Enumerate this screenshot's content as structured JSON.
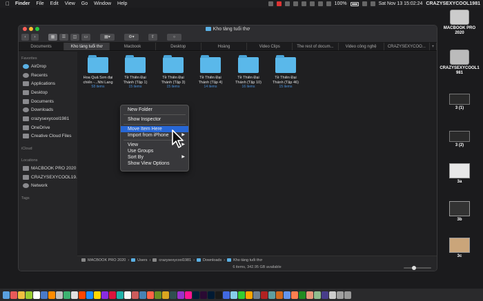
{
  "menubar": {
    "app": "Finder",
    "menus": [
      "File",
      "Edit",
      "View",
      "Go",
      "Window",
      "Help"
    ],
    "battery": "100%",
    "datetime": "Sat Nov 13  15:02:24",
    "user": "CRAZYSEXYCOOL1981",
    "icons": [
      "apple-icon",
      "wifi-icon",
      "battery-icon",
      "search-icon",
      "control-center-icon"
    ]
  },
  "window": {
    "title": "Kho tàng tuổi thơ",
    "tabs": [
      {
        "label": "Documents",
        "active": false
      },
      {
        "label": "Kho tàng tuổi thơ",
        "active": true
      },
      {
        "label": "Macbook",
        "active": false
      },
      {
        "label": "Desktop",
        "active": false
      },
      {
        "label": "Hoàng",
        "active": false
      },
      {
        "label": "Video Clips",
        "active": false
      },
      {
        "label": "The rest of docum...",
        "active": false
      },
      {
        "label": "Video công nghệ",
        "active": false
      },
      {
        "label": "CRAZYSEXYCOO...",
        "active": false
      },
      {
        "label": "+",
        "active": false
      }
    ],
    "sidebar": {
      "favorites_header": "Favorites",
      "favorites": [
        "AirDrop",
        "Recents",
        "Applications",
        "Desktop",
        "Documents",
        "Downloads",
        "crazysexycool1981",
        "OneDrive",
        "Creative Cloud Files"
      ],
      "icloud_header": "iCloud",
      "locations_header": "Locations",
      "locations": [
        "MACBOOK PRO 2020",
        "CRAZYSEXYCOOL19...",
        "Network"
      ],
      "tags_header": "Tags"
    },
    "folders": [
      {
        "name1": "Hoa Quả Sơn đại",
        "name2": "chiến -...Nhi Lang",
        "count": "58 items"
      },
      {
        "name1": "Tề Thiên Đại",
        "name2": "Thánh (Tập 1)",
        "count": "15 items"
      },
      {
        "name1": "Tề Thiên Đại",
        "name2": "Thánh (Tập 3)",
        "count": "15 items"
      },
      {
        "name1": "Tề Thiên Đại",
        "name2": "Thánh (Tập 4)",
        "count": "14 items"
      },
      {
        "name1": "Tề Thiên Đại",
        "name2": "Thánh (Tập 10)",
        "count": "16 items"
      },
      {
        "name1": "Tề Thiên Đại",
        "name2": "Thánh (Tập 46)",
        "count": "15 items"
      }
    ],
    "pathbar": [
      "MACBOOK PRO 2020",
      "Users",
      "crazysexycool1981",
      "Downloads",
      "Kho tàng tuổi thơ"
    ],
    "status": "6 items, 342.95 GB available",
    "icon_size_level": 0.35
  },
  "context_menu": {
    "new_folder": "New Folder",
    "show_inspector": "Show Inspector",
    "move_item_here": "Move Item Here",
    "import_from_iphone": "Import from iPhone",
    "view": "View",
    "use_groups": "Use Groups",
    "sort_by": "Sort By",
    "show_view_options": "Show View Options",
    "highlight_color": "#2767d6"
  },
  "desktop": [
    {
      "label": "MACBOOK PRO",
      "label2": "2020"
    },
    {
      "label": "CRAZYSEXYCOOL1",
      "label2": "981"
    },
    {
      "label": "3 (1)",
      "label2": ""
    },
    {
      "label": "3 (2)",
      "label2": ""
    },
    {
      "label": "3a",
      "label2": ""
    },
    {
      "label": "3b",
      "label2": ""
    },
    {
      "label": "3c",
      "label2": ""
    }
  ],
  "colors": {
    "folder": "#5ab8ea",
    "accent": "#2767d6",
    "count": "#4a90d9"
  }
}
